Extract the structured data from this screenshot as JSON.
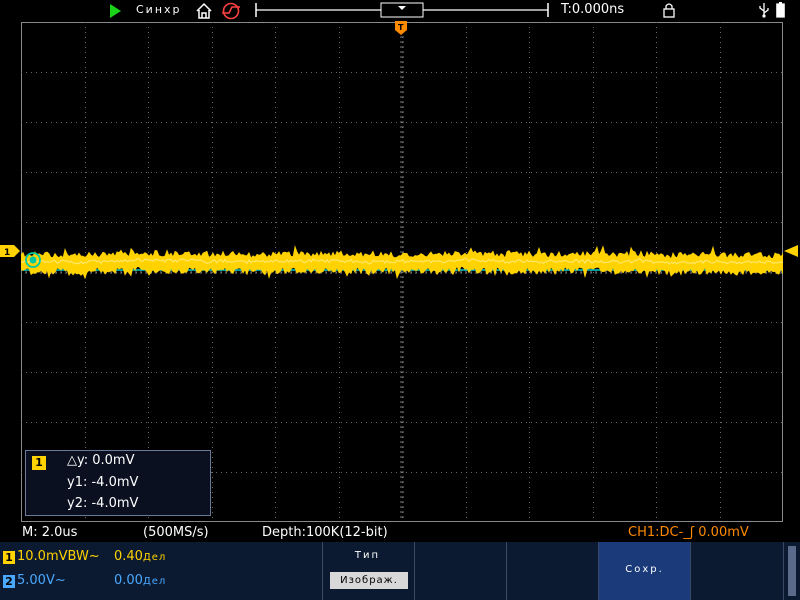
{
  "status_bar": {
    "run_state_icon": "play-icon",
    "sync_label": "Синхр",
    "time_offset": "T:0.000ns",
    "icons": [
      "home-icon",
      "trigger-edge-icon",
      "lock-icon",
      "usb-icon",
      "battery-icon"
    ]
  },
  "cursor_readout": {
    "channel": "1",
    "delta_y": "△y: 0.0mV",
    "y1": "y1: -4.0mV",
    "y2": "y2: -4.0mV"
  },
  "info_line": {
    "time_scale": "M: 2.0us",
    "sample_rate": "(500MS/s)",
    "depth": "Depth:100K(12-bit)",
    "trigger": "CH1:DC-_ʃ 0.00mV"
  },
  "channels": [
    {
      "badge": "1",
      "scale": "10.0mVBW~",
      "offset": "0.40",
      "offset_unit": "Дел",
      "color": "#ffd200"
    },
    {
      "badge": "2",
      "scale": "5.00V~",
      "offset": "0.00",
      "offset_unit": "Дел",
      "color": "#4aa8ff"
    }
  ],
  "menu": {
    "type_label": "Тип",
    "type_value": "Изображ.",
    "save_label": "Сохр."
  },
  "colors": {
    "ch1": "#ffd200",
    "ch2": "#4aa8ff",
    "trigger": "#ff8a00",
    "cursor_line": "#00c8c8",
    "grid": "#8a8a8a"
  }
}
